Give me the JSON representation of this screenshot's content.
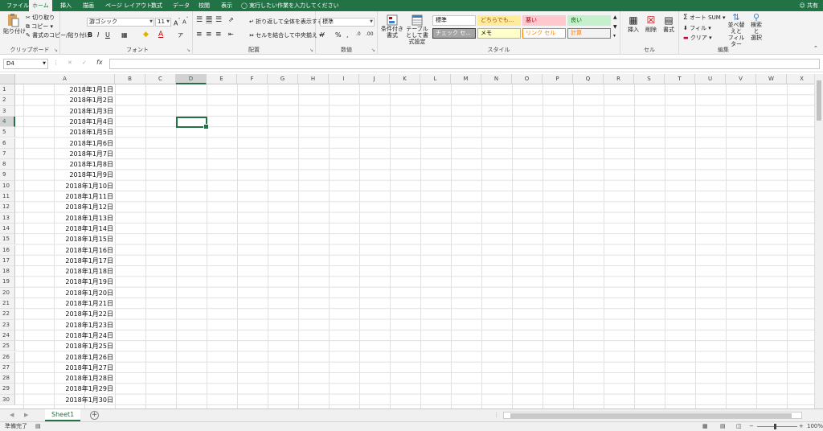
{
  "tabs": [
    "ファイル",
    "ホーム",
    "挿入",
    "描画",
    "ページ レイアウト",
    "数式",
    "データ",
    "校閲",
    "表示"
  ],
  "tell_me": "実行したい作業を入力してください",
  "share": "共有",
  "ribbon": {
    "clipboard": {
      "label": "クリップボード",
      "paste": "貼り付け",
      "cut": "切り取り",
      "copy": "コピー",
      "format_painter": "書式のコピー/貼り付け"
    },
    "font": {
      "label": "フォント",
      "font_name": "游ゴシック",
      "font_size": "11"
    },
    "alignment": {
      "label": "配置",
      "wrap": "折り返して全体を表示する",
      "merge": "セルを結合して中央揃え"
    },
    "number": {
      "label": "数値",
      "format": "標準"
    },
    "styles": {
      "label": "スタイル",
      "conditional": "条件付き書式",
      "table": "テーブルとして書式設定",
      "cells": [
        {
          "text": "標準",
          "bg": "#ffffff",
          "color": "#000000",
          "border": "#c6c6c6"
        },
        {
          "text": "どちらでも...",
          "bg": "#ffeb9c",
          "color": "#9c5700",
          "border": "#ffeb9c"
        },
        {
          "text": "悪い",
          "bg": "#ffc7ce",
          "color": "#9c0006",
          "border": "#ffc7ce"
        },
        {
          "text": "良い",
          "bg": "#c6efce",
          "color": "#006100",
          "border": "#c6efce"
        },
        {
          "text": "チェック セ...",
          "bg": "#a5a5a5",
          "color": "#ffffff",
          "border": "#3f3f3f"
        },
        {
          "text": "メモ",
          "bg": "#ffffcc",
          "color": "#000000",
          "border": "#b2b2b2"
        },
        {
          "text": "リンク セル",
          "bg": "#ffffff",
          "color": "#fa7d00",
          "border": "#ff8001"
        },
        {
          "text": "計算",
          "bg": "#f2f2f2",
          "color": "#fa7d00",
          "border": "#7f7f7f"
        }
      ]
    },
    "cells": {
      "label": "セル",
      "insert": "挿入",
      "delete": "削除",
      "format": "書式"
    },
    "editing": {
      "label": "編集",
      "autosum": "オート SUM",
      "fill": "フィル",
      "clear": "クリア",
      "sort": "並べ替えと\nフィルター",
      "find": "検索と\n選択"
    }
  },
  "name_box": "D4",
  "columns": [
    "A",
    "B",
    "C",
    "D",
    "E",
    "F",
    "G",
    "H",
    "I",
    "J",
    "K",
    "L",
    "M",
    "N",
    "O",
    "P",
    "Q",
    "R",
    "S",
    "T",
    "U",
    "V",
    "W",
    "X"
  ],
  "selected_column": "D",
  "selected_row": 4,
  "rows": [
    1,
    2,
    3,
    4,
    5,
    6,
    7,
    8,
    9,
    10,
    11,
    12,
    13,
    14,
    15,
    16,
    17,
    18,
    19,
    20,
    21,
    22,
    23,
    24,
    25,
    26,
    27,
    28,
    29,
    30
  ],
  "column_a_values": [
    "2018年1月1日",
    "2018年1月2日",
    "2018年1月3日",
    "2018年1月4日",
    "2018年1月5日",
    "2018年1月6日",
    "2018年1月7日",
    "2018年1月8日",
    "2018年1月9日",
    "2018年1月10日",
    "2018年1月11日",
    "2018年1月12日",
    "2018年1月13日",
    "2018年1月14日",
    "2018年1月15日",
    "2018年1月16日",
    "2018年1月17日",
    "2018年1月18日",
    "2018年1月19日",
    "2018年1月20日",
    "2018年1月21日",
    "2018年1月22日",
    "2018年1月23日",
    "2018年1月24日",
    "2018年1月25日",
    "2018年1月26日",
    "2018年1月27日",
    "2018年1月28日",
    "2018年1月29日",
    "2018年1月30日"
  ],
  "sheet_tab": "Sheet1",
  "status": {
    "ready": "準備完了",
    "zoom": "100%"
  },
  "colors": {
    "accent": "#217346"
  }
}
